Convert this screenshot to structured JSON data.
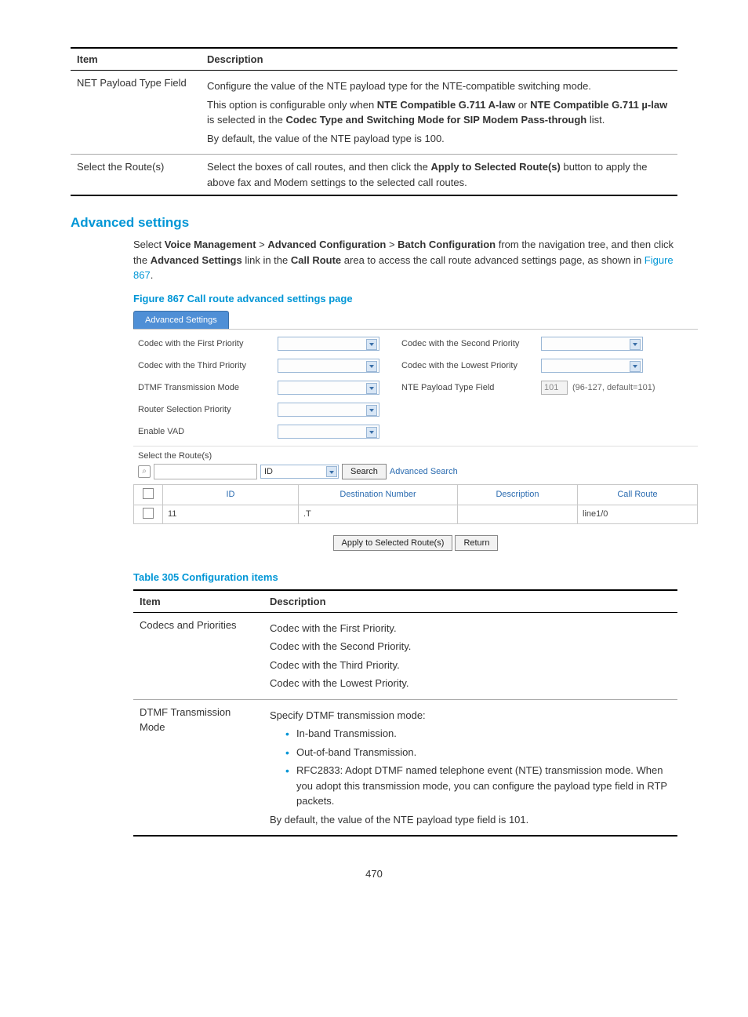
{
  "table304": {
    "headers": {
      "item": "Item",
      "description": "Description"
    },
    "rows": [
      {
        "item": "NET Payload Type Field",
        "desc_p1": "Configure the value of the NTE payload type for the NTE-compatible switching mode.",
        "desc_p2a": "This option is configurable only when ",
        "desc_p2b": "NTE Compatible G.711 A-law",
        "desc_p2c": " or ",
        "desc_p2d": "NTE Compatible G.711 µ-law",
        "desc_p2e": " is selected in the ",
        "desc_p2f": "Codec Type and Switching Mode for SIP Modem Pass-through",
        "desc_p2g": " list.",
        "desc_p3": "By default, the value of the NTE payload type is 100."
      },
      {
        "item": "Select the Route(s)",
        "desc_a": "Select the boxes of call routes, and then click the ",
        "desc_b": "Apply to Selected Route(s)",
        "desc_c": " button to apply the above fax and Modem settings to the selected call routes."
      }
    ]
  },
  "section_title": "Advanced settings",
  "body_text": {
    "a": "Select ",
    "b": "Voice Management",
    "c": " > ",
    "d": "Advanced Configuration",
    "e": "Batch Configuration",
    "f": " from the navigation tree, and then click the ",
    "g": "Advanced Settings",
    "h": " link in the ",
    "i": "Call Route",
    "j": " area to access the call route advanced settings page, as shown in ",
    "k": "Figure 867",
    "l": "."
  },
  "figure_caption": "Figure 867 Call route advanced settings page",
  "screenshot": {
    "tab": "Advanced Settings",
    "labels": {
      "codec1": "Codec with the First Priority",
      "codec2": "Codec with the Second Priority",
      "codec3": "Codec with the Third Priority",
      "codec4": "Codec with the Lowest Priority",
      "dtmf": "DTMF Transmission Mode",
      "nte": "NTE Payload Type Field",
      "router": "Router Selection Priority",
      "vad": "Enable VAD",
      "select_routes": "Select the Route(s)"
    },
    "nte_value": "101",
    "nte_hint": "(96-127, default=101)",
    "search": {
      "dropdown": "ID",
      "button": "Search",
      "advanced": "Advanced Search"
    },
    "table": {
      "headers": {
        "id": "ID",
        "dest": "Destination Number",
        "desc": "Description",
        "route": "Call Route"
      },
      "row": {
        "id": "11",
        "dest": ".T",
        "desc": "",
        "route": "line1/0"
      }
    },
    "buttons": {
      "apply": "Apply to Selected Route(s)",
      "return": "Return"
    }
  },
  "table305_caption": "Table 305 Configuration items",
  "table305": {
    "headers": {
      "item": "Item",
      "description": "Description"
    },
    "rows": [
      {
        "item": "Codecs and Priorities",
        "lines": [
          "Codec with the First Priority.",
          "Codec with the Second Priority.",
          "Codec with the Third Priority.",
          "Codec with the Lowest Priority."
        ]
      },
      {
        "item": "DTMF Transmission Mode",
        "intro": "Specify DTMF transmission mode:",
        "bullets": [
          "In-band Transmission.",
          "Out-of-band Transmission.",
          "RFC2833: Adopt DTMF named telephone event (NTE) transmission mode. When you adopt this transmission mode, you can configure the payload type field in RTP packets."
        ],
        "outro": "By default, the value of the NTE payload type field is 101."
      }
    ]
  },
  "page_number": "470"
}
